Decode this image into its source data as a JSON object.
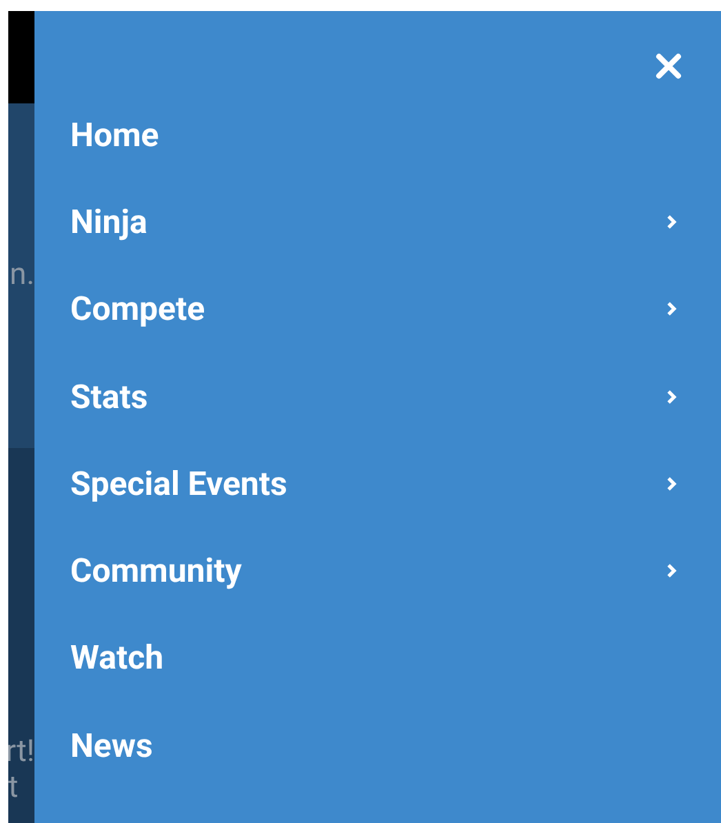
{
  "background_page": {
    "texts": [
      "n.",
      "rt!",
      "t"
    ]
  },
  "menu": {
    "items": [
      {
        "label": "Home",
        "has_submenu": false
      },
      {
        "label": "Ninja",
        "has_submenu": true
      },
      {
        "label": "Compete",
        "has_submenu": true
      },
      {
        "label": "Stats",
        "has_submenu": true
      },
      {
        "label": "Special Events",
        "has_submenu": true
      },
      {
        "label": "Community",
        "has_submenu": true
      },
      {
        "label": "Watch",
        "has_submenu": false
      },
      {
        "label": "News",
        "has_submenu": false
      }
    ]
  }
}
